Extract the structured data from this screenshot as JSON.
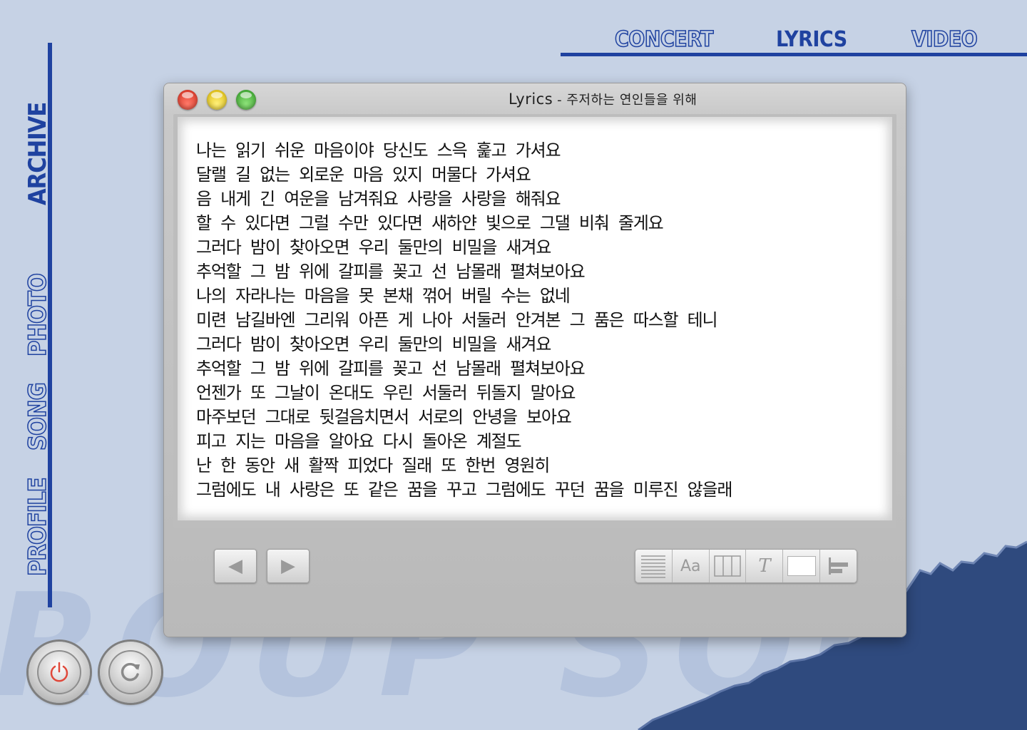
{
  "watermark": "ROUP SOUN",
  "top_nav": {
    "concert": "CONCERT",
    "lyrics": "LYRICS",
    "video": "VIDEO",
    "active": "LYRICS"
  },
  "left_nav": {
    "profile": "PROFILE",
    "song": "SONG",
    "photo": "PHOTO",
    "archive": "ARCHIVE"
  },
  "window": {
    "title": "Lyrics",
    "subtitle": "- 주저하는 연인들을 위해",
    "lyrics": [
      "나는 읽기 쉬운 마음이야 당신도 스윽 훑고 가셔요",
      "달랠 길 없는 외로운 마음 있지 머물다 가셔요",
      "음 내게 긴 여운을 남겨줘요 사랑을 사랑을 해줘요",
      "할 수 있다면 그럴 수만 있다면 새하얀 빛으로 그댈 비춰 줄게요",
      "그러다 밤이 찾아오면 우리 둘만의 비밀을 새겨요",
      "추억할 그 밤 위에 갈피를 꽂고 선 남몰래 펼쳐보아요",
      "나의 자라나는 마음을 못 본채 꺾어 버릴 수는 없네",
      "미련 남길바엔 그리워 아픈 게 나아 서둘러 안겨본 그 품은 따스할 테니",
      "그러다 밤이 찾아오면 우리 둘만의 비밀을 새겨요",
      "추억할 그 밤 위에 갈피를 꽂고 선 남몰래 펼쳐보아요",
      "언젠가 또 그날이 온대도 우린 서둘러 뒤돌지 말아요",
      "마주보던 그대로 뒷걸음치면서 서로의 안녕을 보아요",
      "피고 지는 마음을 알아요 다시 돌아온 계절도",
      "난 한 동안 새 활짝 피었다 질래 또 한번 영원히",
      "그럼에도 내 사랑은 또 같은 꿈을 꾸고 그럼에도 꾸던 꿈을 미루진 않을래"
    ]
  },
  "toolbar": {
    "font_label": "Aa",
    "text_style_label": "T"
  },
  "colors": {
    "background": "#c6d2e5",
    "accent_blue": "#1f42a0",
    "torn_paper": "#2f4a7e",
    "close": "#e0483a",
    "minimize": "#e9c81d",
    "maximize": "#4bb43a"
  },
  "icons": {
    "prev": "triangle-left",
    "next": "triangle-right",
    "power": "power-icon",
    "refresh": "refresh-icon"
  }
}
